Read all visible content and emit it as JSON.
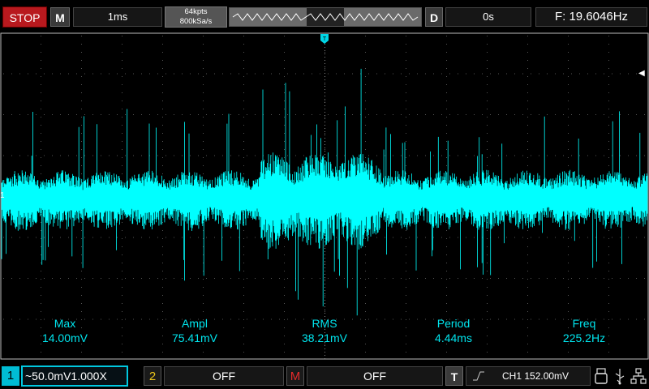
{
  "top": {
    "run_state": "STOP",
    "menu_key": "M",
    "timebase": "1ms",
    "memory_depth": "64kpts",
    "sample_rate": "800kSa/s",
    "delay_key": "D",
    "delay": "0s",
    "frequency_counter": "F: 19.6046Hz"
  },
  "screen": {
    "trigger_marker": "T",
    "channel_marker": "1"
  },
  "measurements": [
    {
      "name": "Max",
      "value": "14.00mV"
    },
    {
      "name": "Ampl",
      "value": "75.41mV"
    },
    {
      "name": "RMS",
      "value": "38.21mV"
    },
    {
      "name": "Period",
      "value": "4.44ms"
    },
    {
      "name": "Freq",
      "value": "225.2Hz"
    }
  ],
  "bottom": {
    "ch1_key": "1",
    "ch1_setting": "~50.0mV1.000X",
    "ch2_key": "2",
    "ch2_setting": "OFF",
    "math_key": "M",
    "math_setting": "OFF",
    "trigger_key": "T",
    "trigger_setting": "CH1 152.00mV"
  },
  "colors": {
    "ch1_trace": "#00ffff",
    "measure_text": "#00e5ee",
    "stop": "#b8191e",
    "ch2": "#e8c21a",
    "math": "#e12a2a"
  }
}
